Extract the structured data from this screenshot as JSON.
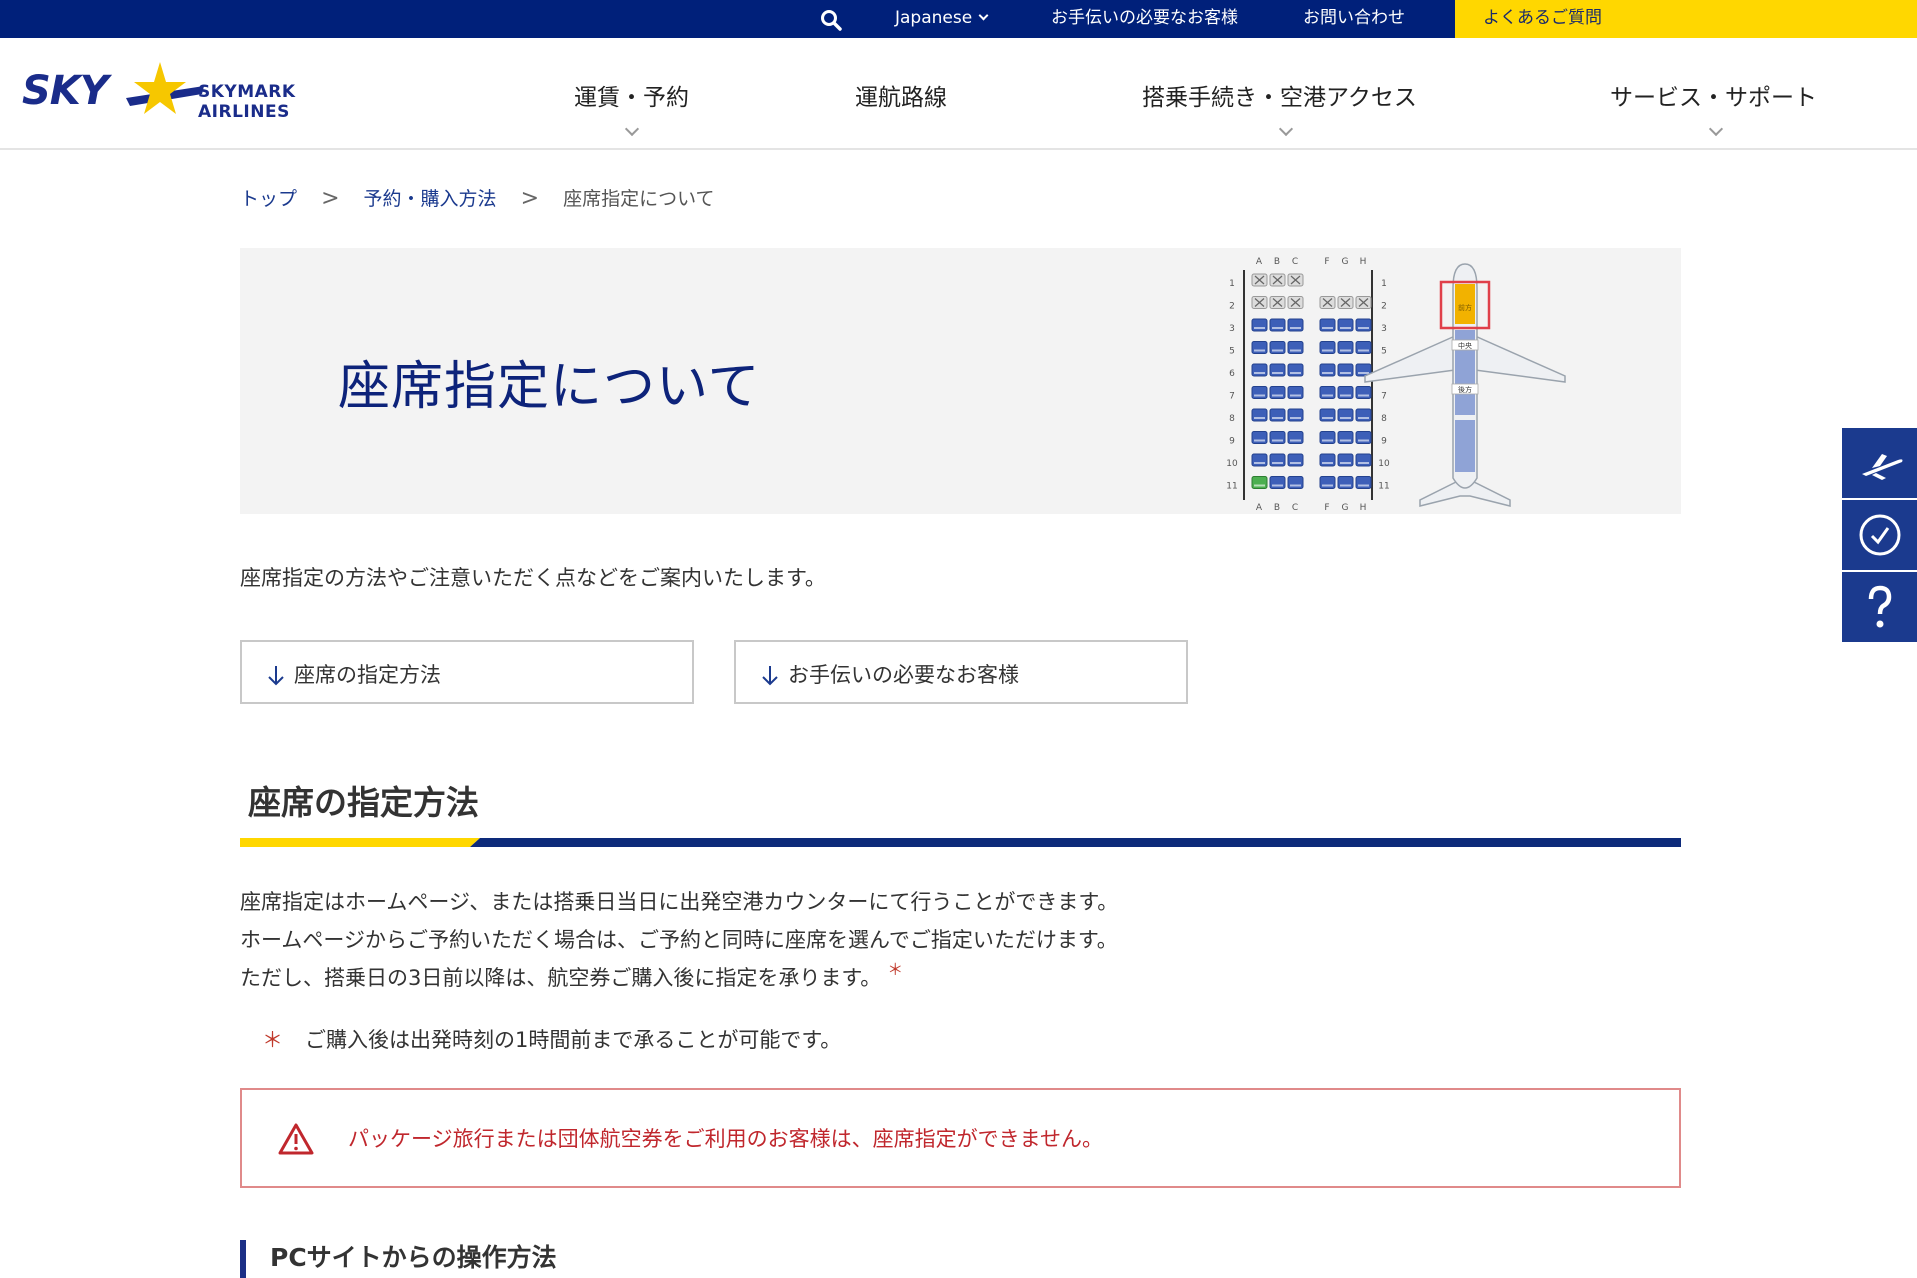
{
  "topbar": {
    "search_icon": "search-icon",
    "language": "Japanese",
    "assist": "お手伝いの必要なお客様",
    "contact": "お問い合わせ",
    "faq": "よくあるご質問"
  },
  "header": {
    "logo_sky": "SKY",
    "logo_name": "SKYMARK AIRLINES",
    "nav": [
      {
        "label": "運賃・予約"
      },
      {
        "label": "運航路線"
      },
      {
        "label": "搭乗手続き・空港アクセス"
      },
      {
        "label": "サービス・サポート"
      }
    ]
  },
  "side_tabs": [
    {
      "icon": "airplane-icon"
    },
    {
      "icon": "clock-icon"
    },
    {
      "icon": "question-icon"
    }
  ],
  "breadcrumb": {
    "items": [
      "トップ",
      "予約・購入方法",
      "座席指定について"
    ],
    "separator": ">"
  },
  "hero": {
    "title": "座席指定について",
    "seat_columns_left": [
      "A",
      "B",
      "C"
    ],
    "seat_columns_right": [
      "F",
      "G",
      "H"
    ],
    "seat_rows": [
      "1",
      "2",
      "3",
      "5",
      "6",
      "7",
      "8",
      "9",
      "10",
      "11"
    ],
    "zone_front": "前方",
    "zone_middle": "中央",
    "zone_rear": "後方"
  },
  "intro": "座席指定の方法やご注意いただく点などをご案内いたします。",
  "anchors": [
    {
      "label": "座席の指定方法"
    },
    {
      "label": "お手伝いの必要なお客様"
    }
  ],
  "section": {
    "title": "座席の指定方法",
    "paragraphs": [
      "座席指定はホームページ、または搭乗日当日に出発空港カウンターにて行うことができます。",
      "ホームページからご予約いただく場合は、ご予約と同時に座席を選んでご指定いただけます。",
      "ただし、搭乗日の3日前以降は、航空券ご購入後に指定を承ります。"
    ],
    "footnote_mark": "＊",
    "note_mark": "＊",
    "note": "ご購入後は出発時刻の1時間前まで承ることが可能です。",
    "alert": "パッケージ旅行または団体航空券をご利用のお客様は、座席指定ができません。",
    "subheading": "PCサイトからの操作方法"
  },
  "colors": {
    "navy": "#00207a",
    "yellow": "#ffd700",
    "alert_red": "#c0272d"
  }
}
